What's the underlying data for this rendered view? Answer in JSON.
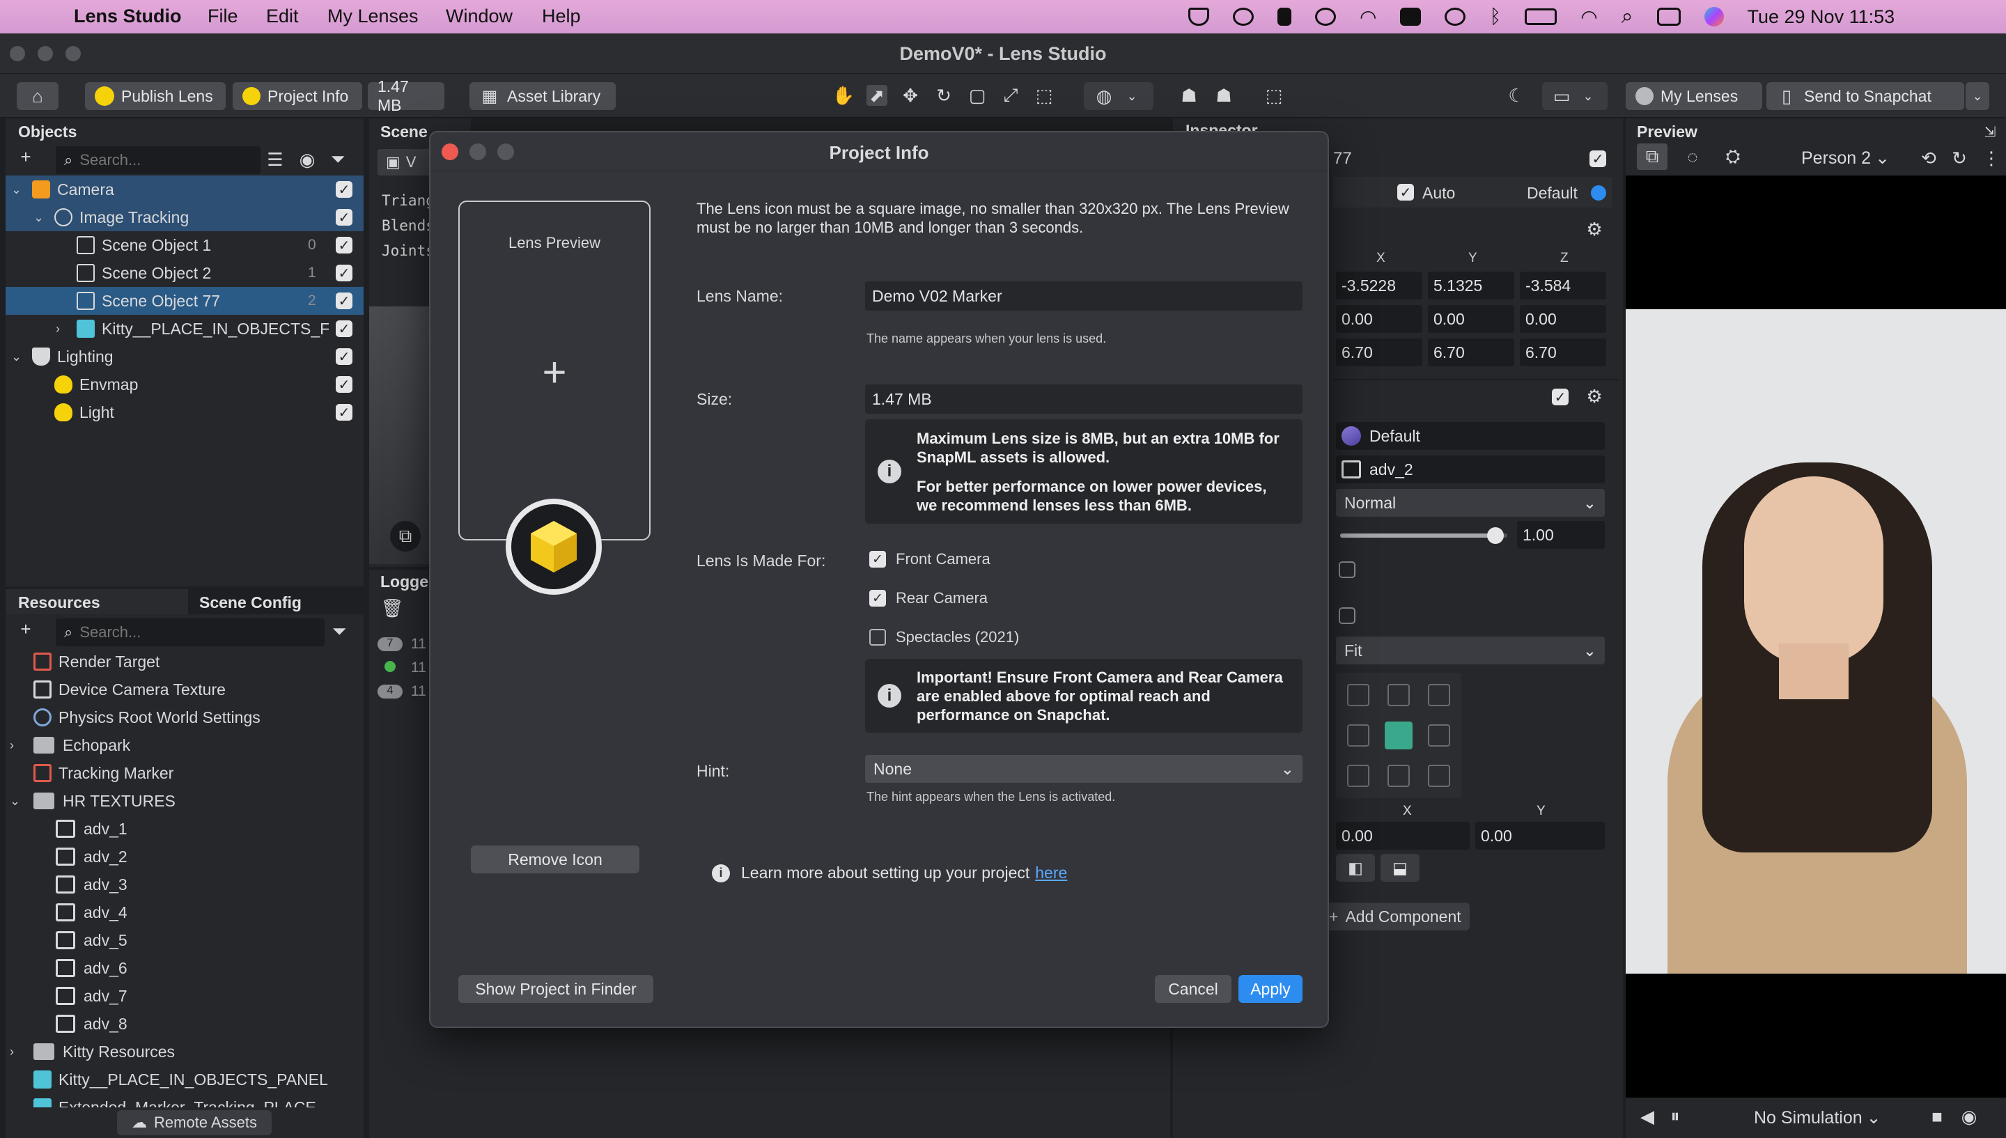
{
  "menubar": {
    "app_name": "Lens Studio",
    "items": [
      "File",
      "Edit",
      "My Lenses",
      "Window",
      "Help"
    ],
    "clock": "Tue 29 Nov  11:53"
  },
  "window": {
    "title": "DemoV0* - Lens Studio"
  },
  "toolbar": {
    "publish_label": "Publish Lens",
    "project_info_label": "Project Info",
    "size_label": "1.47 MB",
    "asset_library_label": "Asset Library",
    "my_lenses_label": "My Lenses",
    "send_label": "Send to Snapchat"
  },
  "objects_panel": {
    "title": "Objects",
    "search_placeholder": "Search...",
    "items": [
      {
        "label": "Camera",
        "indent": 0,
        "expand": "v",
        "icon": "camera-icon"
      },
      {
        "label": "Image Tracking",
        "indent": 1,
        "expand": "v",
        "icon": "image-tracking-icon"
      },
      {
        "label": "Scene Object 1",
        "indent": 2,
        "expand": "",
        "icon": "scene-object-icon",
        "index": "0"
      },
      {
        "label": "Scene Object 2",
        "indent": 2,
        "expand": "",
        "icon": "scene-object-icon",
        "index": "1"
      },
      {
        "label": "Scene Object 77",
        "indent": 2,
        "expand": "",
        "icon": "scene-object-icon",
        "index": "2"
      },
      {
        "label": "Kitty__PLACE_IN_OBJECTS_F",
        "indent": 2,
        "expand": ">",
        "icon": "prefab-icon"
      },
      {
        "label": "Lighting",
        "indent": 0,
        "expand": "v",
        "icon": "lighting-icon"
      },
      {
        "label": "Envmap",
        "indent": 1,
        "expand": "",
        "icon": "light-bulb-icon"
      },
      {
        "label": "Light",
        "indent": 1,
        "expand": "",
        "icon": "light-bulb-icon"
      }
    ]
  },
  "resources_panel": {
    "tab_resources": "Resources",
    "tab_scene_config": "Scene Config",
    "search_placeholder": "Search...",
    "items": [
      {
        "label": "Render Target",
        "expand": "",
        "icon": "render-target-icon",
        "indent": 0
      },
      {
        "label": "Device Camera Texture",
        "expand": "",
        "icon": "device-camera-icon",
        "indent": 0
      },
      {
        "label": "Physics Root World Settings",
        "expand": "",
        "icon": "physics-icon",
        "indent": 0
      },
      {
        "label": "Echopark",
        "expand": ">",
        "icon": "folder-icon",
        "indent": 0
      },
      {
        "label": "Tracking Marker",
        "expand": "",
        "icon": "tracking-marker-icon",
        "indent": 0
      },
      {
        "label": "HR TEXTURES",
        "expand": "v",
        "icon": "folder-icon",
        "indent": 0
      },
      {
        "label": "adv_1",
        "expand": "",
        "icon": "image-icon",
        "indent": 1
      },
      {
        "label": "adv_2",
        "expand": "",
        "icon": "image-icon",
        "indent": 1
      },
      {
        "label": "adv_3",
        "expand": "",
        "icon": "image-icon",
        "indent": 1
      },
      {
        "label": "adv_4",
        "expand": "",
        "icon": "image-icon",
        "indent": 1
      },
      {
        "label": "adv_5",
        "expand": "",
        "icon": "image-icon",
        "indent": 1
      },
      {
        "label": "adv_6",
        "expand": "",
        "icon": "image-icon",
        "indent": 1
      },
      {
        "label": "adv_7",
        "expand": "",
        "icon": "image-icon",
        "indent": 1
      },
      {
        "label": "adv_8",
        "expand": "",
        "icon": "image-icon",
        "indent": 1
      },
      {
        "label": "Kitty Resources",
        "expand": ">",
        "icon": "folder-icon",
        "indent": 0
      },
      {
        "label": "Kitty__PLACE_IN_OBJECTS_PANEL",
        "expand": "",
        "icon": "prefab-icon",
        "indent": 0
      },
      {
        "label": "Extended_Marker_Tracking_PLACE",
        "expand": "",
        "icon": "prefab-icon",
        "indent": 0
      }
    ],
    "remote_assets_label": "Remote Assets"
  },
  "scene_panel": {
    "title": "Scene",
    "overlay_lines": [
      "Triang",
      "Blends",
      "Joints"
    ],
    "tab_partial": "V"
  },
  "logger_panel": {
    "title": "Logge",
    "rows": [
      {
        "badge": "7",
        "text": "11"
      },
      {
        "badge": "",
        "text": "11"
      },
      {
        "badge": "4",
        "text": "11"
      }
    ]
  },
  "inspector": {
    "title": "Inspector",
    "name_partial": "77",
    "auto_label": "Auto",
    "default_label": "Default",
    "axes": [
      "X",
      "Y",
      "Z"
    ],
    "position": [
      "-3.5228",
      "5.1325",
      "-3.584"
    ],
    "rotation": [
      "0.00",
      "0.00",
      "0.00"
    ],
    "scale": [
      "6.70",
      "6.70",
      "6.70"
    ],
    "material": "Default",
    "texture": "adv_2",
    "blend_mode": "Normal",
    "opacity": "1.00",
    "opacity_fraction": 0.93,
    "stretch_mode": "Fit",
    "pivot_x_label": "X",
    "pivot_y_label": "Y",
    "pivot_x": "0.00",
    "pivot_y": "0.00",
    "add_component_label": "Add Component"
  },
  "preview": {
    "title": "Preview",
    "person_label": "Person 2",
    "simulation_label": "No Simulation"
  },
  "dialog": {
    "title": "Project Info",
    "lens_preview_label": "Lens Preview",
    "remove_icon_label": "Remove Icon",
    "show_in_finder_label": "Show Project in Finder",
    "intro_text": "The Lens icon must be a square image, no smaller than 320x320 px. The Lens Preview must be no larger than 10MB and longer than 3 seconds.",
    "lens_name_label": "Lens Name:",
    "lens_name_value": "Demo V02 Marker",
    "lens_name_help": "The name appears when your lens is used.",
    "size_label": "Size:",
    "size_value": "1.47 MB",
    "size_notice_1": "Maximum Lens size is 8MB, but an extra 10MB for SnapML assets is allowed.",
    "size_notice_2": "For better performance on lower power devices, we recommend lenses less than 6MB.",
    "made_for_label": "Lens Is Made For:",
    "opt_front": "Front Camera",
    "opt_rear": "Rear Camera",
    "opt_spectacles": "Spectacles (2021)",
    "camera_notice": "Important! Ensure Front Camera and Rear Camera are enabled above for optimal reach and performance on Snapchat.",
    "hint_label": "Hint:",
    "hint_value": "None",
    "hint_help": "The hint appears when the Lens is activated.",
    "learn_more_text": "Learn more about setting up your project",
    "learn_more_link": "here",
    "cancel_label": "Cancel",
    "apply_label": "Apply"
  },
  "colors": {
    "accent_blue": "#2d8cf0",
    "selection": "#2d4f73",
    "link": "#5aa9ff",
    "dialog_bg": "#33353a"
  }
}
